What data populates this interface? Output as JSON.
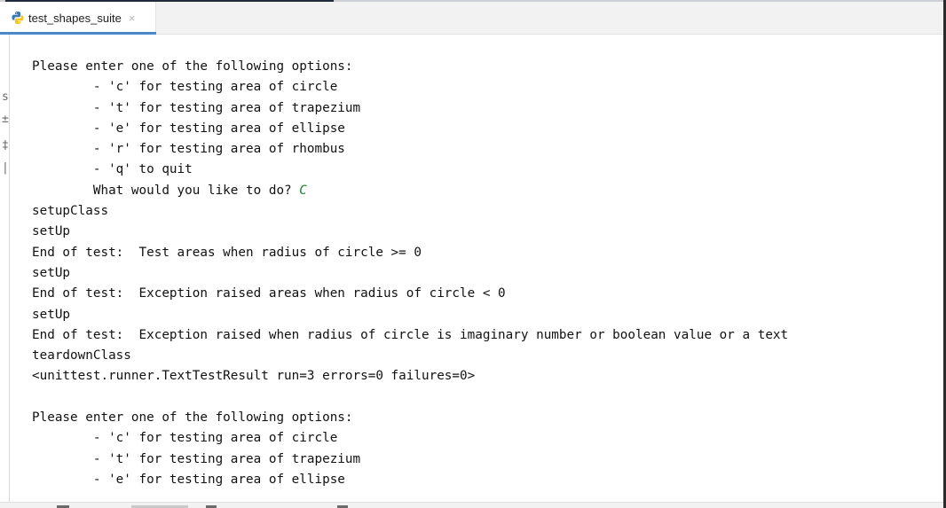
{
  "tab": {
    "title": "test_shapes_suite",
    "close_glyph": "×",
    "icon": "python-icon"
  },
  "console": {
    "lines": [
      {
        "text": "Please enter one of the following options:"
      },
      {
        "text": "        - 'c' for testing area of circle"
      },
      {
        "text": "        - 't' for testing area of trapezium"
      },
      {
        "text": "        - 'e' for testing area of ellipse"
      },
      {
        "text": "        - 'r' for testing area of rhombus"
      },
      {
        "text": "        - 'q' to quit"
      },
      {
        "text": "        What would you like to do? ",
        "input": "C"
      },
      {
        "text": "setupClass"
      },
      {
        "text": "setUp"
      },
      {
        "text": "End of test:  Test areas when radius of circle >= 0"
      },
      {
        "text": "setUp"
      },
      {
        "text": "End of test:  Exception raised areas when radius of circle < 0"
      },
      {
        "text": "setUp"
      },
      {
        "text": "End of test:  Exception raised when radius of circle is imaginary number or boolean value or a text"
      },
      {
        "text": "teardownClass"
      },
      {
        "text": "<unittest.runner.TextTestResult run=3 errors=0 failures=0>"
      },
      {
        "text": ""
      },
      {
        "text": "Please enter one of the following options:"
      },
      {
        "text": "        - 'c' for testing area of circle"
      },
      {
        "text": "        - 't' for testing area of trapezium"
      },
      {
        "text": "        - 'e' for testing area of ellipse"
      }
    ],
    "input_color": "#1d8a2e",
    "text_color": "#111111"
  },
  "colors": {
    "tab_underline": "#4a88c7",
    "background": "#ffffff"
  }
}
